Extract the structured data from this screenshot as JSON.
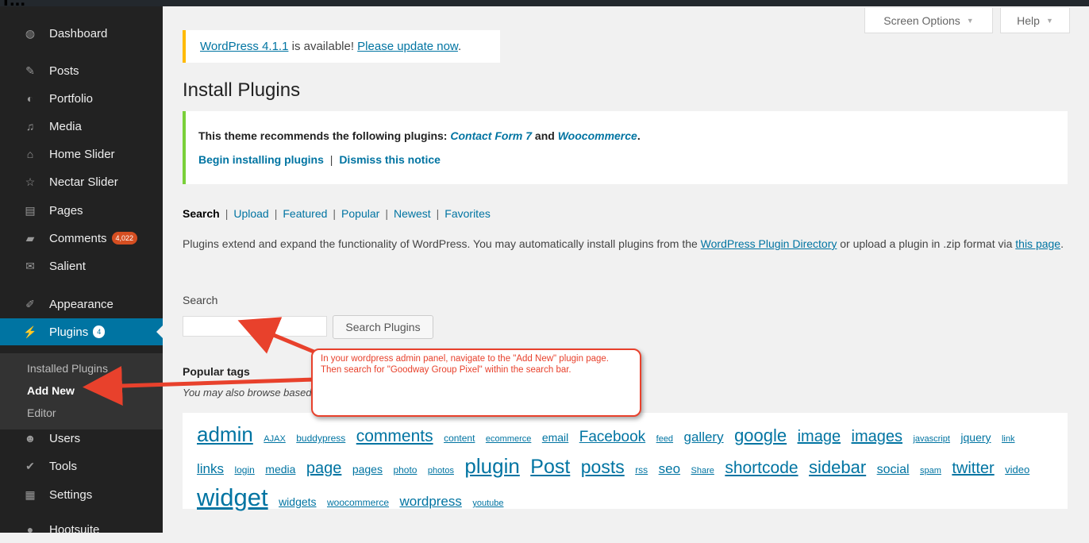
{
  "corner_text": "T...",
  "sidebar": {
    "items": [
      {
        "label": "Dashboard",
        "icon": "dashboard-icon"
      },
      {
        "label": "Posts",
        "icon": "pin-icon"
      },
      {
        "label": "Portfolio",
        "icon": "portfolio-icon"
      },
      {
        "label": "Media",
        "icon": "media-icon"
      },
      {
        "label": "Home Slider",
        "icon": "home-icon"
      },
      {
        "label": "Nectar Slider",
        "icon": "star-icon"
      },
      {
        "label": "Pages",
        "icon": "pages-icon"
      },
      {
        "label": "Comments",
        "icon": "comment-icon",
        "badge": "4,022"
      },
      {
        "label": "Salient",
        "icon": "mail-icon"
      },
      {
        "label": "Appearance",
        "icon": "brush-icon"
      },
      {
        "label": "Plugins",
        "icon": "plugin-icon",
        "badge": "4",
        "active": true
      },
      {
        "label": "Users",
        "icon": "users-icon"
      },
      {
        "label": "Tools",
        "icon": "wrench-icon"
      },
      {
        "label": "Settings",
        "icon": "settings-icon"
      },
      {
        "label": "Hootsuite",
        "icon": "owl-icon"
      }
    ],
    "submenu": [
      "Installed Plugins",
      "Add New",
      "Editor"
    ]
  },
  "top_tabs": {
    "screen_options": "Screen Options",
    "help": "Help"
  },
  "update_nag": {
    "version_link": "WordPress 4.1.1",
    "middle": " is available! ",
    "update_link": "Please update now",
    "end": "."
  },
  "page_title": "Install Plugins",
  "theme_notice": {
    "text": "This theme recommends the following plugins: ",
    "plugin1": "Contact Form 7",
    "and": " and ",
    "plugin2": "Woocommerce",
    "end": ".",
    "begin_link": "Begin installing plugins",
    "separator": "|",
    "dismiss_link": "Dismiss this notice"
  },
  "filters": [
    "Search",
    "Upload",
    "Featured",
    "Popular",
    "Newest",
    "Favorites"
  ],
  "description": {
    "part1": "Plugins extend and expand the functionality of WordPress. You may automatically install plugins from the ",
    "link1": "WordPress Plugin Directory",
    "part2": " or upload a plugin in .zip format via ",
    "link2": "this page",
    "part3": "."
  },
  "search": {
    "label": "Search",
    "value": "",
    "button": "Search Plugins"
  },
  "popular_tags": {
    "heading": "Popular tags",
    "browse_text": "You may also browse based on the most popular tags in the Plugin Directory:"
  },
  "tags": [
    {
      "t": "admin",
      "s": 26
    },
    {
      "t": "AJAX",
      "s": 11
    },
    {
      "t": "buddypress",
      "s": 12
    },
    {
      "t": "comments",
      "s": 21
    },
    {
      "t": "content",
      "s": 12
    },
    {
      "t": "ecommerce",
      "s": 11
    },
    {
      "t": "email",
      "s": 14
    },
    {
      "t": "Facebook",
      "s": 19
    },
    {
      "t": "feed",
      "s": 11
    },
    {
      "t": "gallery",
      "s": 17
    },
    {
      "t": "google",
      "s": 22
    },
    {
      "t": "image",
      "s": 20
    },
    {
      "t": "images",
      "s": 20
    },
    {
      "t": "javascript",
      "s": 11
    },
    {
      "t": "jquery",
      "s": 14
    },
    {
      "t": "link",
      "s": 11
    },
    {
      "t": "links",
      "s": 17
    },
    {
      "t": "login",
      "s": 12
    },
    {
      "t": "media",
      "s": 14
    },
    {
      "t": "page",
      "s": 20
    },
    {
      "t": "pages",
      "s": 14
    },
    {
      "t": "photo",
      "s": 12
    },
    {
      "t": "photos",
      "s": 11
    },
    {
      "t": "plugin",
      "s": 26
    },
    {
      "t": "Post",
      "s": 25
    },
    {
      "t": "posts",
      "s": 23
    },
    {
      "t": "rss",
      "s": 12
    },
    {
      "t": "seo",
      "s": 17
    },
    {
      "t": "Share",
      "s": 11
    },
    {
      "t": "shortcode",
      "s": 21
    },
    {
      "t": "sidebar",
      "s": 22
    },
    {
      "t": "social",
      "s": 16
    },
    {
      "t": "spam",
      "s": 11
    },
    {
      "t": "twitter",
      "s": 20
    },
    {
      "t": "video",
      "s": 13
    },
    {
      "t": "widget",
      "s": 31
    },
    {
      "t": "widgets",
      "s": 14
    },
    {
      "t": "woocommerce",
      "s": 12
    },
    {
      "t": "wordpress",
      "s": 17
    },
    {
      "t": "youtube",
      "s": 11
    }
  ],
  "callout_text": "In your wordpress admin panel, navigate to the \"Add New\" plugin page. Then search for \"Goodway Group Pixel\" within the search bar.",
  "colors": {
    "sidebar_bg": "#222222",
    "active": "#0074a2",
    "link": "#0074a2",
    "update_border": "#ffba00",
    "notice_border": "#7ad03a",
    "callout_red": "#e8412c",
    "badge": "#d54e21"
  }
}
